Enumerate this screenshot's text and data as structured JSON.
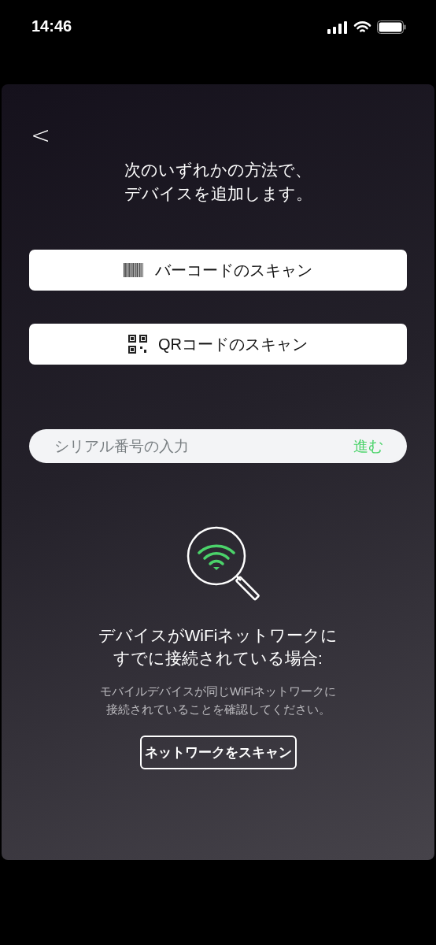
{
  "status_bar": {
    "time": "14:46"
  },
  "back": {
    "label": "<"
  },
  "title": {
    "lines": [
      "次のいずれかの方法で、",
      "デバイスを追加します。"
    ]
  },
  "scan_options": [
    {
      "kind": "barcode",
      "label": "バーコードのスキャン"
    },
    {
      "kind": "qr",
      "label": "QRコードのスキャン"
    }
  ],
  "serial_field": {
    "placeholder": "シリアル番号の入力",
    "action": "進む"
  },
  "wifi_section": {
    "heading": [
      "デバイスがWiFiネットワークに",
      "すでに接続されている場合:"
    ],
    "note": [
      "モバイルデバイスが同じWiFiネットワークに",
      "接続されていることを確認してください。"
    ],
    "button": "ネットワークをスキャン"
  }
}
